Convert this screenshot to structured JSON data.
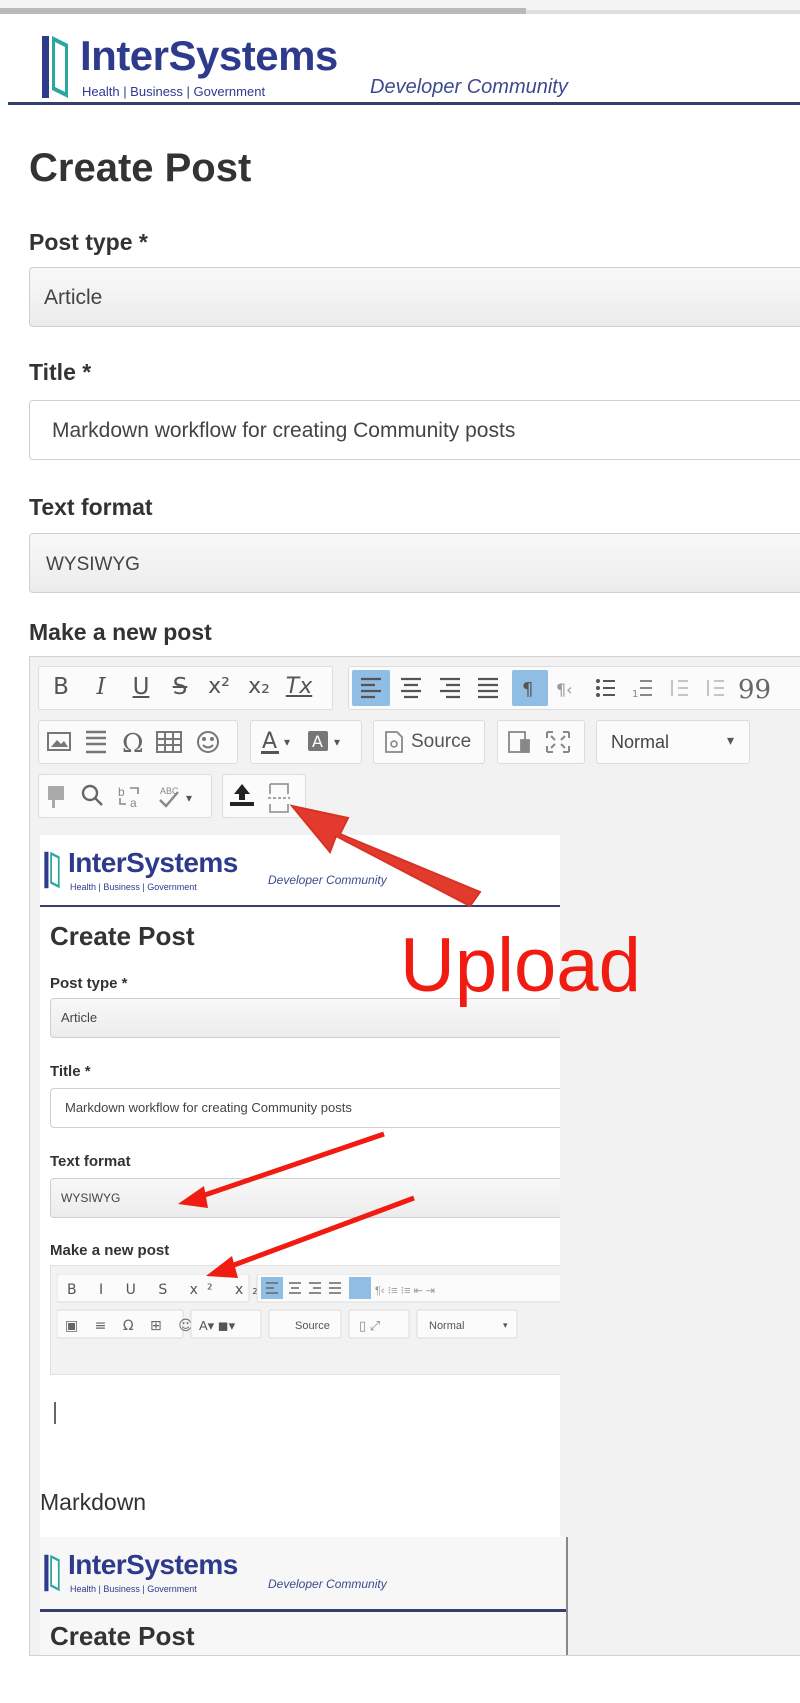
{
  "brand": {
    "name": "InterSystems",
    "tagline": "Health | Business | Government",
    "subtitle": "Developer Community",
    "colors": {
      "navy": "#2e3a8c",
      "teal": "#2ba7a0",
      "rule": "#34406b"
    }
  },
  "page": {
    "title": "Create Post"
  },
  "form": {
    "post_type_label": "Post type *",
    "post_type_value": "Article",
    "title_label": "Title *",
    "title_value": "Markdown workflow for creating Community posts",
    "text_format_label": "Text format",
    "text_format_value": "WYSIWYG",
    "editor_label": "Make a new post"
  },
  "editor": {
    "format_buttons": [
      "B",
      "I",
      "U",
      "S",
      "x²",
      "x₂",
      "Tx"
    ],
    "align_buttons": [
      "align-left",
      "align-center",
      "align-right",
      "justify",
      "ltr",
      "rtl",
      "bulleted-list",
      "numbered-list",
      "outdent",
      "indent",
      "blockquote"
    ],
    "source_label": "Source",
    "style_value": "Normal",
    "style_caret": "▾"
  },
  "annotations": {
    "upload_label": "Upload",
    "markdown_caption": "Markdown",
    "arrow_color": "#f01c12"
  }
}
